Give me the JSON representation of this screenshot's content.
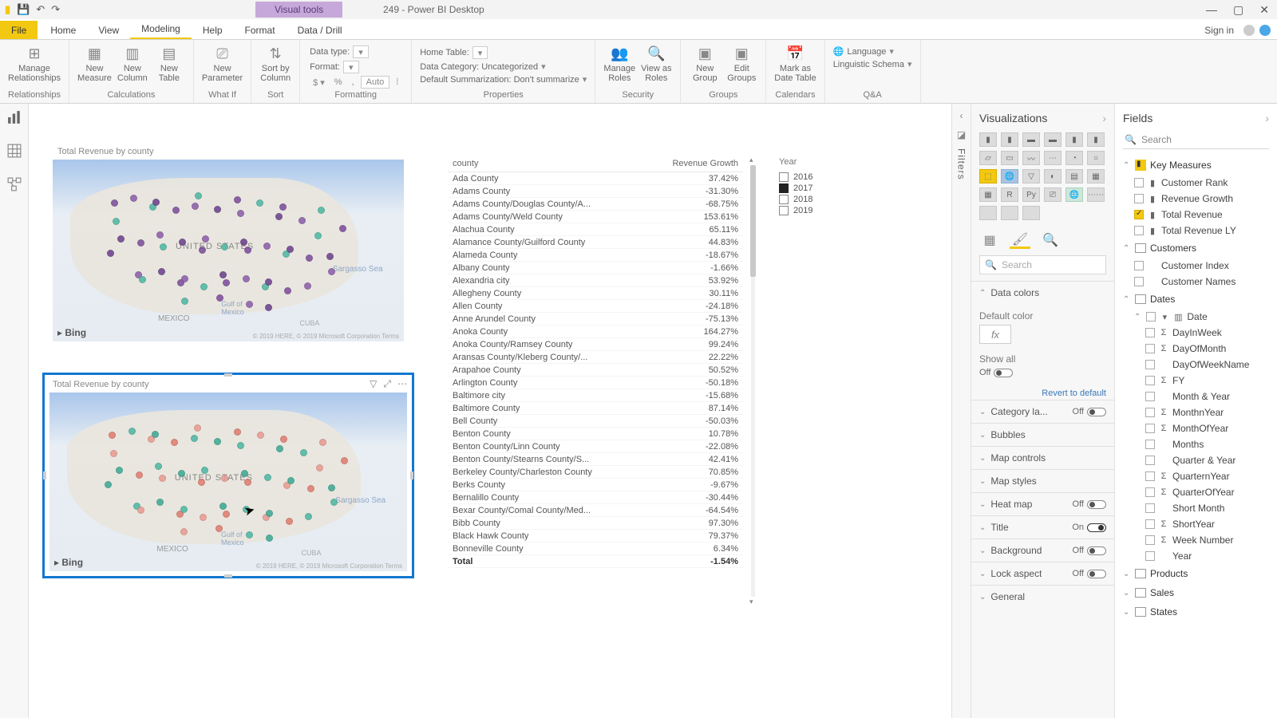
{
  "titlebar": {
    "visual_tools": "Visual tools",
    "doc_title": "249 - Power BI Desktop"
  },
  "menubar": {
    "file": "File",
    "tabs": [
      "Home",
      "View",
      "Modeling",
      "Help",
      "Format",
      "Data / Drill"
    ],
    "active_tab_index": 2,
    "signin": "Sign in"
  },
  "ribbon": {
    "relationships": {
      "manage": "Manage\nRelationships",
      "group": "Relationships"
    },
    "calculations": {
      "measure": "New\nMeasure",
      "column": "New\nColumn",
      "table": "New\nTable",
      "group": "Calculations"
    },
    "whatif": {
      "param": "New\nParameter",
      "group": "What If"
    },
    "sort": {
      "sortby": "Sort by\nColumn",
      "group": "Sort"
    },
    "formatting": {
      "datatype_label": "Data type:",
      "format_label": "Format:",
      "auto": "Auto",
      "group": "Formatting"
    },
    "properties": {
      "home_table": "Home Table:",
      "data_category": "Data Category: Uncategorized",
      "summarization": "Default Summarization: Don't summarize",
      "group": "Properties"
    },
    "security": {
      "manage_roles": "Manage\nRoles",
      "view_as": "View as\nRoles",
      "group": "Security"
    },
    "groups": {
      "new_group": "New\nGroup",
      "edit_groups": "Edit\nGroups",
      "group": "Groups"
    },
    "calendars": {
      "mark": "Mark as\nDate Table",
      "group": "Calendars"
    },
    "qa": {
      "language": "Language",
      "schema": "Linguistic Schema",
      "group": "Q&A"
    }
  },
  "canvas": {
    "map1_title": "Total Revenue by county",
    "map2_title": "Total Revenue by county",
    "map_label_us": "UNITED STATES",
    "map_label_mx": "MEXICO",
    "map_label_cuba": "CUBA",
    "map_label_sea": "Sargasso Sea",
    "map_label_gulf": "Gulf of\nMexico",
    "map_credit": "© 2019 HERE, © 2019 Microsoft Corporation  Terms",
    "bing": "Bing"
  },
  "table": {
    "cols": [
      "county",
      "Revenue Growth"
    ],
    "rows": [
      [
        "Ada County",
        "37.42%"
      ],
      [
        "Adams County",
        "-31.30%"
      ],
      [
        "Adams County/Douglas County/A...",
        "-68.75%"
      ],
      [
        "Adams County/Weld County",
        "153.61%"
      ],
      [
        "Alachua County",
        "65.11%"
      ],
      [
        "Alamance County/Guilford County",
        "44.83%"
      ],
      [
        "Alameda County",
        "-18.67%"
      ],
      [
        "Albany County",
        "-1.66%"
      ],
      [
        "Alexandria city",
        "53.92%"
      ],
      [
        "Allegheny County",
        "30.11%"
      ],
      [
        "Allen County",
        "-24.18%"
      ],
      [
        "Anne Arundel County",
        "-75.13%"
      ],
      [
        "Anoka County",
        "164.27%"
      ],
      [
        "Anoka County/Ramsey County",
        "99.24%"
      ],
      [
        "Aransas County/Kleberg County/...",
        "22.22%"
      ],
      [
        "Arapahoe County",
        "50.52%"
      ],
      [
        "Arlington County",
        "-50.18%"
      ],
      [
        "Baltimore city",
        "-15.68%"
      ],
      [
        "Baltimore County",
        "87.14%"
      ],
      [
        "Bell County",
        "-50.03%"
      ],
      [
        "Benton County",
        "10.78%"
      ],
      [
        "Benton County/Linn County",
        "-22.08%"
      ],
      [
        "Benton County/Stearns County/S...",
        "42.41%"
      ],
      [
        "Berkeley County/Charleston County",
        "70.85%"
      ],
      [
        "Berks County",
        "-9.67%"
      ],
      [
        "Bernalillo County",
        "-30.44%"
      ],
      [
        "Bexar County/Comal County/Med...",
        "-64.54%"
      ],
      [
        "Bibb County",
        "97.30%"
      ],
      [
        "Black Hawk County",
        "79.37%"
      ],
      [
        "Bonneville County",
        "6.34%"
      ]
    ],
    "total_label": "Total",
    "total_value": "-1.54%"
  },
  "slicer": {
    "header": "Year",
    "items": [
      {
        "label": "2016",
        "checked": false
      },
      {
        "label": "2017",
        "checked": true
      },
      {
        "label": "2018",
        "checked": false
      },
      {
        "label": "2019",
        "checked": false
      }
    ]
  },
  "filters_rail": {
    "label": "Filters"
  },
  "viz_pane": {
    "title": "Visualizations",
    "search_placeholder": "Search",
    "sections": {
      "data_colors": "Data colors",
      "default_color": "Default color",
      "show_all": "Show all",
      "off": "Off",
      "on": "On",
      "revert": "Revert to default",
      "category_labels": "Category la...",
      "bubbles": "Bubbles",
      "map_controls": "Map controls",
      "map_styles": "Map styles",
      "heat_map": "Heat map",
      "title": "Title",
      "background": "Background",
      "lock_aspect": "Lock aspect",
      "general": "General"
    },
    "fx": "fx"
  },
  "fields_pane": {
    "title": "Fields",
    "search_placeholder": "Search",
    "tables": {
      "key_measures": {
        "name": "Key Measures",
        "expanded": true,
        "items": [
          {
            "name": "Customer Rank",
            "type": "measure",
            "checked": false
          },
          {
            "name": "Revenue Growth",
            "type": "measure",
            "checked": false
          },
          {
            "name": "Total Revenue",
            "type": "measure",
            "checked": true
          },
          {
            "name": "Total Revenue LY",
            "type": "measure",
            "checked": false
          }
        ]
      },
      "customers": {
        "name": "Customers",
        "expanded": true,
        "items": [
          {
            "name": "Customer Index",
            "type": "column",
            "checked": false
          },
          {
            "name": "Customer Names",
            "type": "column",
            "checked": false
          }
        ]
      },
      "dates": {
        "name": "Dates",
        "expanded": true,
        "items": [
          {
            "name": "Date",
            "type": "hierarchy",
            "checked": false,
            "expanded": true
          },
          {
            "name": "DayInWeek",
            "type": "sigma",
            "checked": false,
            "sub": true
          },
          {
            "name": "DayOfMonth",
            "type": "sigma",
            "checked": false,
            "sub": true
          },
          {
            "name": "DayOfWeekName",
            "type": "column",
            "checked": false,
            "sub": true
          },
          {
            "name": "FY",
            "type": "sigma",
            "checked": false,
            "sub": true
          },
          {
            "name": "Month & Year",
            "type": "column",
            "checked": false,
            "sub": true
          },
          {
            "name": "MonthnYear",
            "type": "sigma",
            "checked": false,
            "sub": true
          },
          {
            "name": "MonthOfYear",
            "type": "sigma",
            "checked": false,
            "sub": true
          },
          {
            "name": "Months",
            "type": "column",
            "checked": false,
            "sub": true
          },
          {
            "name": "Quarter & Year",
            "type": "column",
            "checked": false,
            "sub": true
          },
          {
            "name": "QuarternYear",
            "type": "sigma",
            "checked": false,
            "sub": true
          },
          {
            "name": "QuarterOfYear",
            "type": "sigma",
            "checked": false,
            "sub": true
          },
          {
            "name": "Short Month",
            "type": "column",
            "checked": false,
            "sub": true
          },
          {
            "name": "ShortYear",
            "type": "sigma",
            "checked": false,
            "sub": true
          },
          {
            "name": "Week Number",
            "type": "sigma",
            "checked": false,
            "sub": true
          },
          {
            "name": "Year",
            "type": "column",
            "checked": false,
            "sub": true
          }
        ]
      },
      "products": {
        "name": "Products",
        "expanded": false
      },
      "sales": {
        "name": "Sales",
        "expanded": false
      },
      "states": {
        "name": "States",
        "expanded": false
      }
    }
  }
}
